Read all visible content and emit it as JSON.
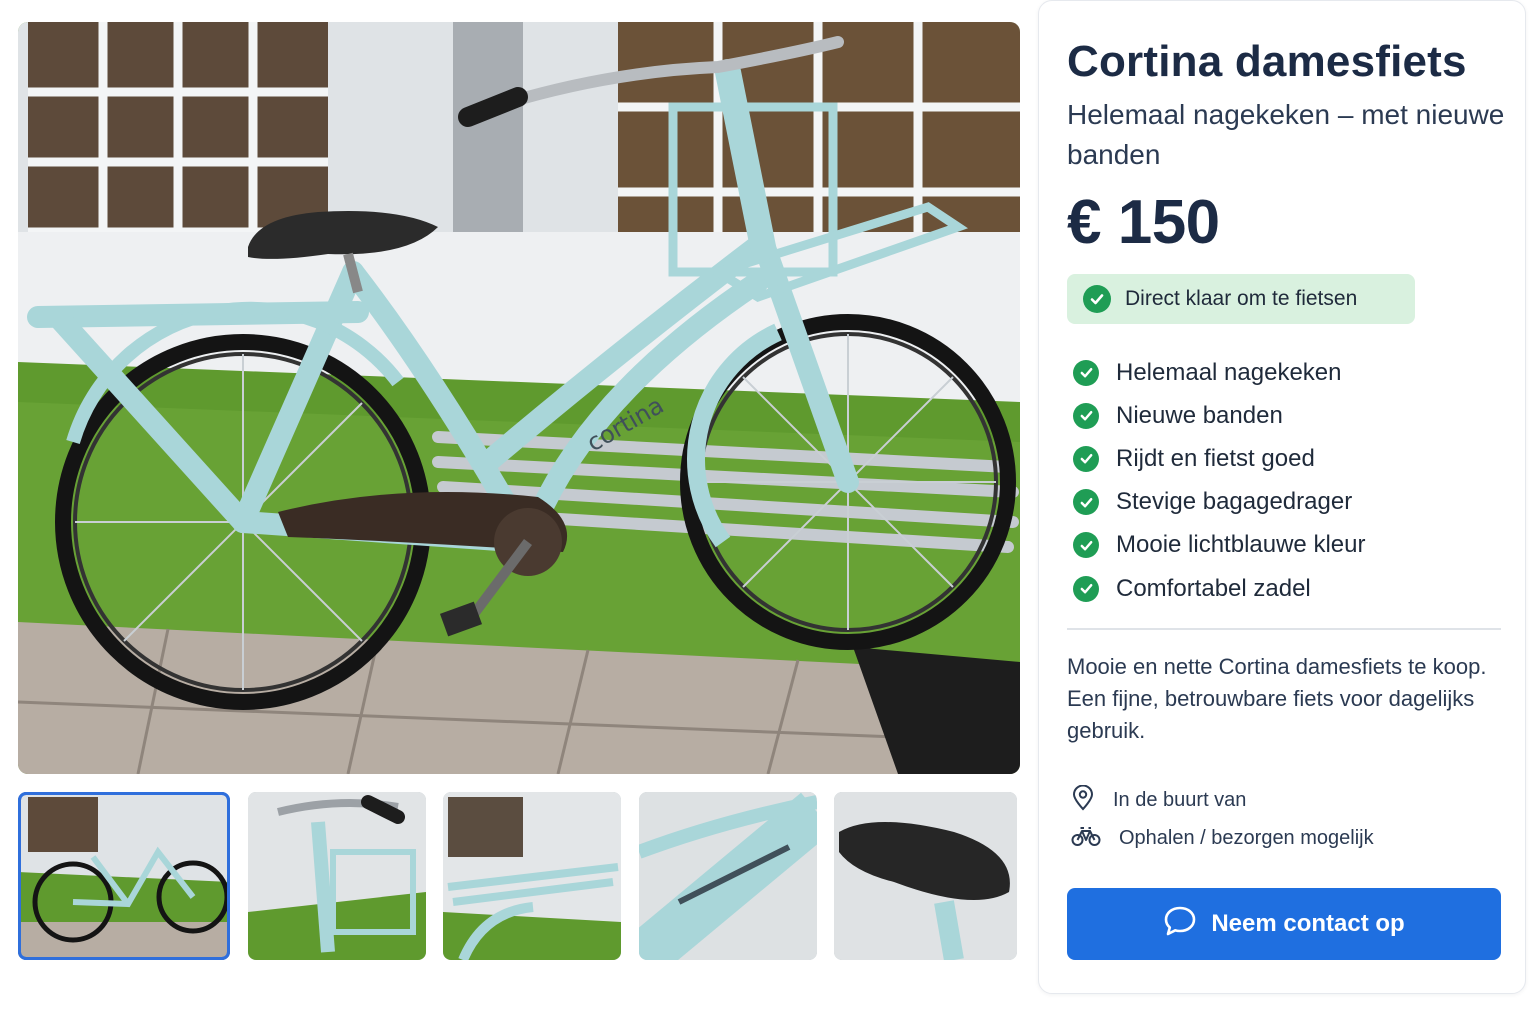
{
  "listing": {
    "title": "Cortina damesfiets",
    "subtitle": "Helemaal nagekeken – met nieuwe banden",
    "price": "€ 150",
    "badge": "Direct klaar om te fietsen",
    "features": [
      "Helemaal nagekeken",
      "Nieuwe banden",
      "Rijdt en fietst goed",
      "Stevige bagagedrager",
      "Mooie lichtblauwe kleur",
      "Comfortabel zadel"
    ],
    "description": "Mooie en nette Cortina damesfiets te koop. Een fijne, betrouwbare fiets voor dagelijks gebruik.",
    "location": "In de buurt van",
    "delivery": "Ophalen / bezorgen mogelijk",
    "contact_label": "Neem contact op"
  },
  "gallery": {
    "active_index": 0,
    "thumbnails": [
      "full-bike-view",
      "handlebar-and-front-basket",
      "rear-rack",
      "frame-logo",
      "saddle"
    ]
  },
  "photo_text": {
    "frame_brand": "cortina"
  },
  "icons": {
    "check": "check-circle-icon",
    "location": "map-pin-icon",
    "bike": "bicycle-icon",
    "chat": "chat-bubble-icon"
  },
  "colors": {
    "bike_frame": "#a9d6d9",
    "accent": "#1f6fe0",
    "success": "#1f9d55",
    "badge_bg": "#d9f1df",
    "heading": "#1c2b45"
  }
}
